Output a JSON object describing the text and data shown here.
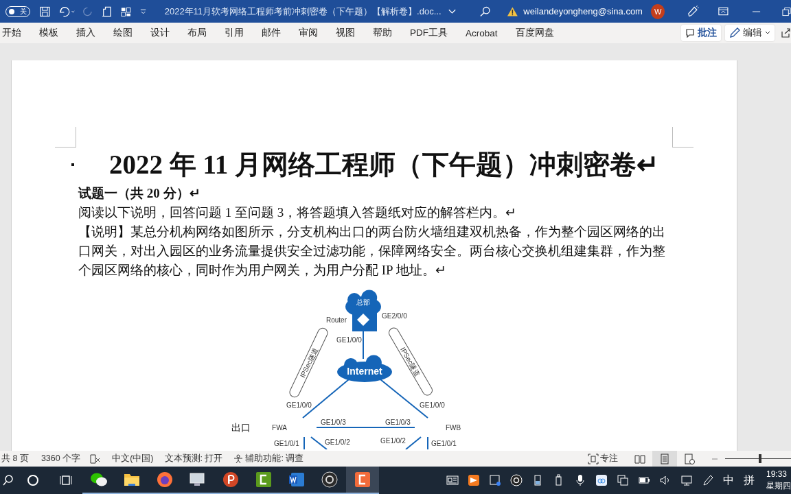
{
  "title_bar": {
    "autosave": {
      "label": "关",
      "on": false
    },
    "title": "2022年11月软考网络工程师考前冲刺密卷（下午题）【解析卷】.doc...",
    "account": "weilandeyongheng@sina.com",
    "avatar": "W"
  },
  "ribbon": {
    "tabs": [
      "开始",
      "模板",
      "插入",
      "绘图",
      "设计",
      "布局",
      "引用",
      "邮件",
      "审阅",
      "视图",
      "帮助",
      "PDF工具",
      "Acrobat",
      "百度网盘"
    ],
    "comment_button": "批注",
    "edit_button": "编辑"
  },
  "document": {
    "heading": "2022 年 11 月网络工程师（下午题）冲刺密卷↵",
    "section_title": "试题一（共 20 分）↵",
    "instruction": "阅读以下说明，回答问题 1 至问题 3，将答题填入答题纸对应的解答栏内。↵",
    "description": "【说明】某总分机构网络如图所示，分支机构出口的两台防火墙组建双机热备，作为整个园区网络的出口网关，对出入园区的业务流量提供安全过滤功能，保障网络安全。两台核心交换机组建集群，作为整个园区网络的核心，同时作为用户网关，为用户分配 IP 地址。↵",
    "diagram": {
      "hq_label": "总部",
      "router_label": "Router",
      "internet_label": "Internet",
      "tunnels": [
        "IPSec隧道",
        "IPSec隧道"
      ],
      "exit_label": "出口",
      "firewalls": [
        "FWA",
        "FWB"
      ],
      "ports": [
        "GE2/0/0",
        "GE1/0/0",
        "GE1/0/0",
        "GE1/0/0",
        "GE1/0/3",
        "GE1/0/3",
        "GE1/0/1",
        "GE1/0/2",
        "GE1/0/2",
        "GE1/0/1"
      ]
    }
  },
  "status_bar": {
    "pages": "共 8 页",
    "words": "3360 个字",
    "language": "中文(中国)",
    "prediction": "文本预测: 打开",
    "accessibility": "辅助功能: 调查",
    "focus": "专注",
    "views": [
      {
        "kind": "read",
        "selected": false
      },
      {
        "kind": "print",
        "selected": true
      },
      {
        "kind": "web",
        "selected": false
      }
    ],
    "zoom": {
      "level": 0.53
    }
  },
  "taskbar": {
    "apps": [
      {
        "kind": "wechat",
        "selected": false
      },
      {
        "kind": "explorer",
        "selected": false
      },
      {
        "kind": "firefox",
        "selected": false
      },
      {
        "kind": "monitor",
        "selected": false
      },
      {
        "kind": "powerpoint",
        "selected": false
      },
      {
        "kind": "camtasia-green",
        "selected": false
      },
      {
        "kind": "word",
        "selected": false
      },
      {
        "kind": "obs",
        "selected": false
      },
      {
        "kind": "camtasia-orange",
        "selected": true
      }
    ],
    "ime": "中",
    "ime_mode": "拼",
    "time": "19:33",
    "weekday": "星期四"
  }
}
